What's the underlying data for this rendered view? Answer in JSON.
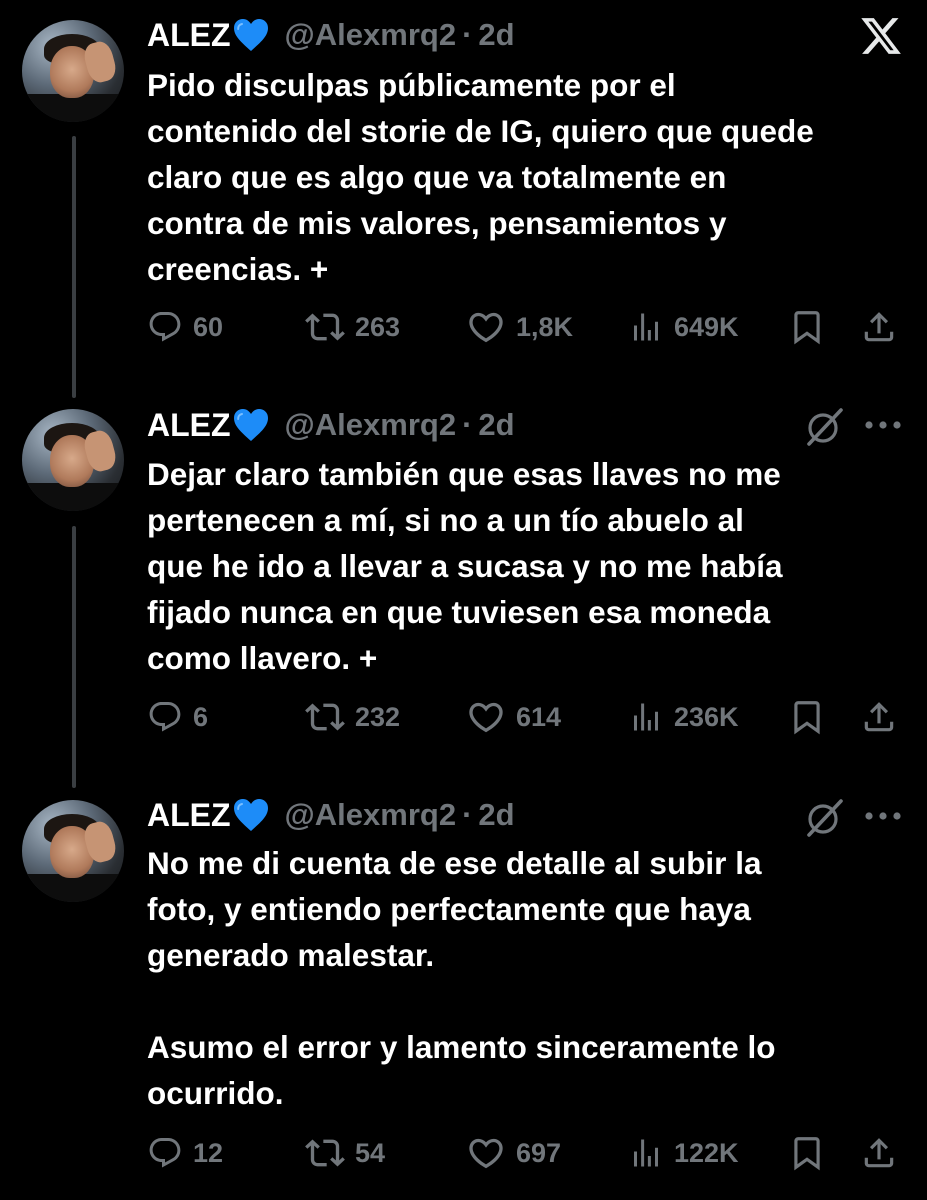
{
  "platform_icon": "x-logo-icon",
  "tweets": [
    {
      "author_name": "ALEZ",
      "verified_emoji": "blue-heart-icon",
      "handle": "@Alexmrq2",
      "separator": "·",
      "time": "2d",
      "text": "Pido disculpas públicamente por el\ncontenido del storie de IG, quiero que quede\nclaro que es algo que va totalmente en\ncontra de mis valores, pensamientos y\ncreencias. +",
      "replies": "60",
      "reposts": "263",
      "likes": "1,8K",
      "views": "649K"
    },
    {
      "author_name": "ALEZ",
      "verified_emoji": "blue-heart-icon",
      "handle": "@Alexmrq2",
      "separator": "·",
      "time": "2d",
      "text": "Dejar claro también que esas llaves no me\npertenecen a mí, si no a un tío abuelo al\nque he ido a llevar a sucasa y no me había\nfijado nunca en que tuviesen esa moneda\ncomo llavero. +",
      "replies": "6",
      "reposts": "232",
      "likes": "614",
      "views": "236K"
    },
    {
      "author_name": "ALEZ",
      "verified_emoji": "blue-heart-icon",
      "handle": "@Alexmrq2",
      "separator": "·",
      "time": "2d",
      "text": "No me di cuenta de ese detalle al subir la\nfoto, y entiendo perfectamente que haya\ngenerado malestar.\n\nAsumo el error y lamento sinceramente lo\nocurrido.",
      "replies": "12",
      "reposts": "54",
      "likes": "697",
      "views": "122K"
    }
  ],
  "colors": {
    "background": "#000000",
    "text": "#ffffff",
    "muted": "#71767b",
    "heart_emoji": "#1d8cf8",
    "thread_line": "#3a3e42"
  }
}
